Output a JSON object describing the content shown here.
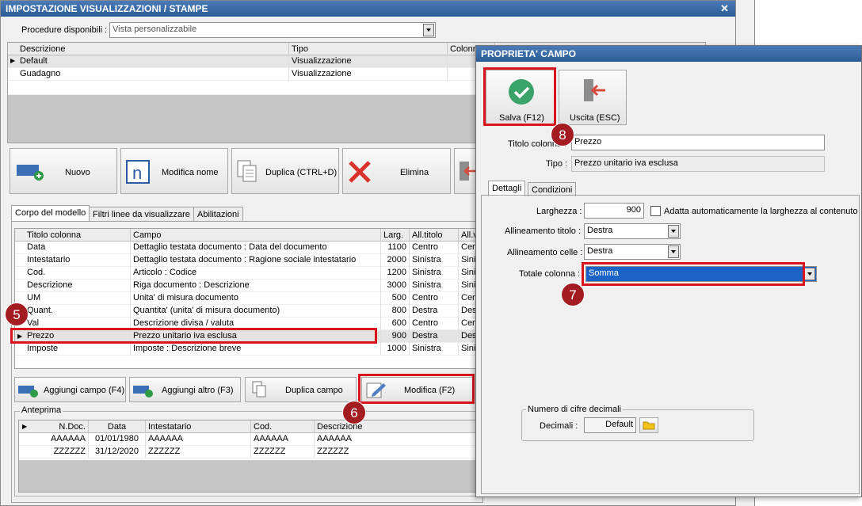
{
  "main_window": {
    "title": "IMPOSTAZIONE VISUALIZZAZIONI / STAMPE",
    "procedure_label": "Procedure disponibili :",
    "procedure_value": "Vista personalizzabile",
    "views_headers": [
      "Descrizione",
      "Tipo",
      "Colonn"
    ],
    "views_rows": [
      {
        "descrizione": "Default",
        "tipo": "Visualizzazione"
      },
      {
        "descrizione": "Guadagno",
        "tipo": "Visualizzazione"
      }
    ],
    "toolbar": {
      "nuovo": "Nuovo",
      "modifica_nome": "Modifica nome",
      "duplica": "Duplica (CTRL+D)",
      "elimina": "Elimina"
    },
    "tabs": [
      "Corpo del modello",
      "Filtri linee da visualizzare",
      "Abilitazioni"
    ],
    "fields_headers": [
      "Titolo colonna",
      "Campo",
      "Larg.",
      "All.titolo",
      "All.v"
    ],
    "fields_rows": [
      {
        "titolo": "Data",
        "campo": "Dettaglio testata documento : Data del documento",
        "larg": "1100",
        "all": "Centro",
        "allv": "Cent"
      },
      {
        "titolo": "Intestatario",
        "campo": "Dettaglio testata documento : Ragione sociale intestatario",
        "larg": "2000",
        "all": "Sinistra",
        "allv": "Sinis"
      },
      {
        "titolo": "Cod.",
        "campo": "Articolo : Codice",
        "larg": "1200",
        "all": "Sinistra",
        "allv": "Sinis"
      },
      {
        "titolo": "Descrizione",
        "campo": "Riga documento : Descrizione",
        "larg": "3000",
        "all": "Sinistra",
        "allv": "Sinis"
      },
      {
        "titolo": "UM",
        "campo": "Unita' di misura documento",
        "larg": "500",
        "all": "Centro",
        "allv": "Cent"
      },
      {
        "titolo": "Quant.",
        "campo": "Quantita' (unita' di misura documento)",
        "larg": "800",
        "all": "Destra",
        "allv": "Dest"
      },
      {
        "titolo": "Val",
        "campo": "Descrizione divisa / valuta",
        "larg": "600",
        "all": "Centro",
        "allv": "Cent"
      },
      {
        "titolo": "Prezzo",
        "campo": "Prezzo unitario iva esclusa",
        "larg": "900",
        "all": "Destra",
        "allv": "Dest"
      },
      {
        "titolo": "Imposte",
        "campo": "Imposte : Descrizione breve",
        "larg": "1000",
        "all": "Sinistra",
        "allv": "Sinis"
      }
    ],
    "field_buttons": {
      "aggiungi_campo": "Aggiungi campo (F4)",
      "aggiungi_altro": "Aggiungi altro (F3)",
      "duplica_campo": "Duplica campo",
      "modifica": "Modifica (F2)"
    },
    "preview": {
      "legend": "Anteprima",
      "headers": [
        "N.Doc.",
        "Data",
        "Intestatario",
        "Cod.",
        "Descrizione"
      ],
      "rows": [
        [
          "AAAAAA",
          "01/01/1980",
          "AAAAAA",
          "AAAAAA",
          "AAAAAA"
        ],
        [
          "ZZZZZZ",
          "31/12/2020",
          "ZZZZZZ",
          "ZZZZZZ",
          "ZZZZZZ"
        ]
      ]
    }
  },
  "dialog": {
    "title": "PROPRIETA' CAMPO",
    "salva": "Salva (F12)",
    "uscita": "Uscita (ESC)",
    "titolo_colonna_label": "Titolo colonna :",
    "titolo_colonna_value": "Prezzo",
    "tipo_label": "Tipo :",
    "tipo_value": "Prezzo unitario iva esclusa",
    "tabs": [
      "Dettagli",
      "Condizioni"
    ],
    "larghezza_label": "Larghezza :",
    "larghezza_value": "900",
    "adatta_label": "Adatta automaticamente la larghezza al contenuto",
    "allineamento_titolo_label": "Allineamento titolo :",
    "allineamento_titolo_value": "Destra",
    "allineamento_celle_label": "Allineamento celle :",
    "allineamento_celle_value": "Destra",
    "totale_label": "Totale colonna :",
    "totale_value": "Somma",
    "decimali_group": "Numero di cifre decimali",
    "decimali_label": "Decimali :",
    "decimali_value": "Default"
  },
  "callouts": [
    "5",
    "6",
    "7",
    "8"
  ],
  "colors": {
    "titlebar": "#3b6ea8",
    "highlight": "#d9141b",
    "badge": "#a21c22",
    "selection": "#1c63c8",
    "save_icon": "#3aa36a"
  }
}
